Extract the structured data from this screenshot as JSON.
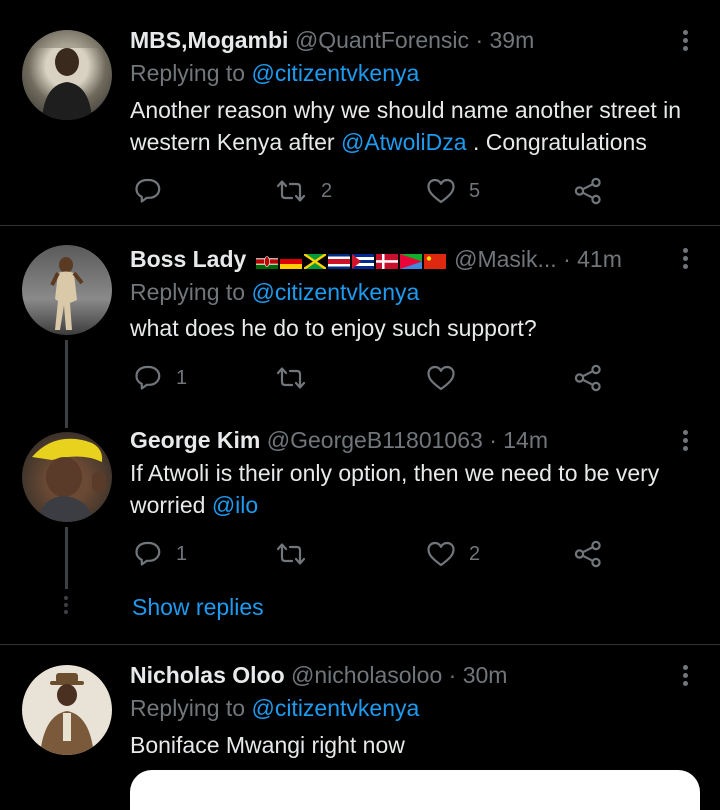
{
  "tweets": [
    {
      "name": "MBS,Mogambi",
      "handle": "@QuantForensic",
      "time": "· 39m",
      "replying_prefix": "Replying to ",
      "replying_to": "@citizentvkenya",
      "text_before": "Another reason why we should name another street in western Kenya after ",
      "mention": "@AtwoliDza",
      "text_after": " . Congratulations",
      "retweets": "2",
      "likes": "5"
    },
    {
      "name": "Boss Lady",
      "handle": "@Masik...",
      "time": "· 41m",
      "replying_prefix": "Replying to ",
      "replying_to": "@citizentvkenya",
      "text": "what does he do to enjoy such support?",
      "replies": "1"
    },
    {
      "name": "George Kim",
      "handle": "@GeorgeB11801063",
      "time": "· 14m",
      "text_before": "If Atwoli is their only option, then we need to be very worried ",
      "mention": "@ilo",
      "replies": "1",
      "likes": "2",
      "show_replies": "Show replies"
    },
    {
      "name": "Nicholas Oloo",
      "handle": "@nicholasoloo",
      "time": "· 30m",
      "replying_prefix": "Replying to ",
      "replying_to": "@citizentvkenya",
      "text": "Boniface Mwangi right now"
    }
  ],
  "colors": {
    "background": "#000000",
    "text": "#e7e9ea",
    "muted": "#71767b",
    "link": "#1d9bf0",
    "divider": "#2f3336"
  },
  "icons": {
    "reply": "reply-icon",
    "retweet": "retweet-icon",
    "like": "heart-icon",
    "share": "share-icon",
    "more": "more-vertical-icon",
    "flags": [
      "kenya-flag-icon",
      "germany-flag-icon",
      "jamaica-flag-icon",
      "costa-rica-flag-icon",
      "cuba-flag-icon",
      "denmark-flag-icon",
      "eritrea-flag-icon",
      "china-flag-icon"
    ]
  }
}
